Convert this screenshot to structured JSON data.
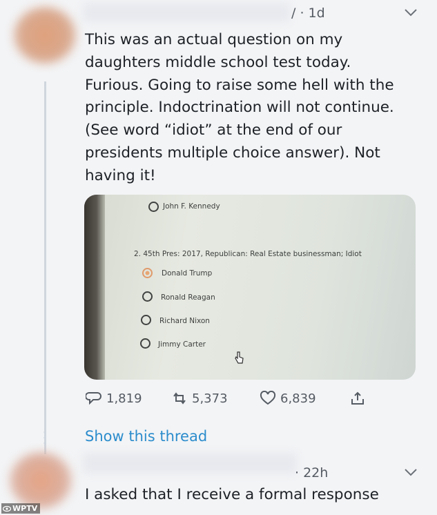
{
  "tweet1": {
    "time": "/ · 1d",
    "text_lines": [
      "This was an actual question on my",
      "daughters middle school test today.",
      "Furious. Going to raise some hell with the",
      "principle. Indoctrination will not continue.",
      "(See word “idiot” at the end of our",
      "presidents multiple choice answer). Not",
      "having it!"
    ],
    "media": {
      "prev_option": "John F. Kennedy",
      "question": "2. 45th Pres: 2017, Republican: Real Estate businessman; Idiot",
      "options": [
        {
          "label": "Donald Trump",
          "selected": true
        },
        {
          "label": "Ronald Reagan",
          "selected": false
        },
        {
          "label": "Richard Nixon",
          "selected": false
        },
        {
          "label": "Jimmy Carter",
          "selected": false
        }
      ]
    },
    "actions": {
      "replies": "1,819",
      "retweets": "5,373",
      "likes": "6,839"
    },
    "show_thread": "Show this thread"
  },
  "tweet2": {
    "time": "· 22h",
    "text": "I asked that I receive a formal response"
  },
  "watermark": "WPTV",
  "colors": {
    "link": "#2b8ccc",
    "selected_radio": "#e8a673",
    "icon_gray": "#555b63"
  }
}
